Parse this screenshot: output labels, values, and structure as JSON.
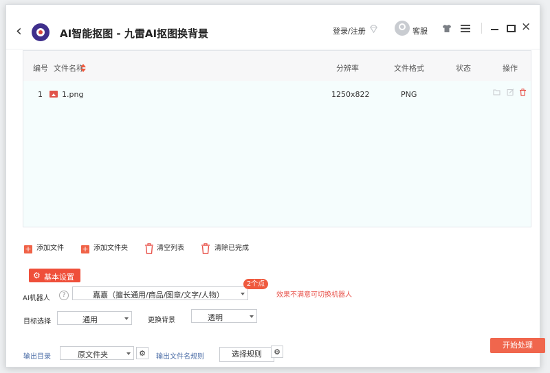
{
  "header": {
    "title": "AI智能抠图 - 九雷AI抠图换背景",
    "login": "登录/注册",
    "service": "客服",
    "icons": [
      "back-arrow-icon",
      "app-logo-icon",
      "diamond-icon",
      "avatar-icon",
      "shirt-icon",
      "menu-icon",
      "minimize-icon",
      "maximize-icon",
      "close-icon"
    ]
  },
  "table": {
    "headers": {
      "index": "编号",
      "filename": "文件名称",
      "resolution": "分辨率",
      "format": "文件格式",
      "status": "状态",
      "actions": "操作"
    },
    "rows": [
      {
        "index": "1",
        "filename": "1.png",
        "resolution": "1250x822",
        "format": "PNG",
        "status": ""
      }
    ]
  },
  "toolbar": {
    "add_file": "添加文件",
    "add_folder": "添加文件夹",
    "clear_list": "清空列表",
    "clear_done": "清除已完成"
  },
  "settings": {
    "section_label": "基本设置",
    "robot_label": "AI机器人",
    "robot_value": "嘉嘉（擅长通用/商品/图章/文字/人物）",
    "robot_badge": "2个点",
    "robot_hint": "效果不满意可切换机器人",
    "target_label": "目标选择",
    "target_value": "通用",
    "bg_label": "更换背景",
    "bg_value": "透明",
    "output_dir_label": "输出目录",
    "output_dir_value": "原文件夹",
    "filename_rule_label": "输出文件名规则",
    "choose_rule": "选择规则",
    "start": "开始处理"
  },
  "colors": {
    "accent": "#ef4f3a",
    "start_button": "#f0664d",
    "hint_text": "#e8534b",
    "link_label": "#4e6fa8"
  }
}
